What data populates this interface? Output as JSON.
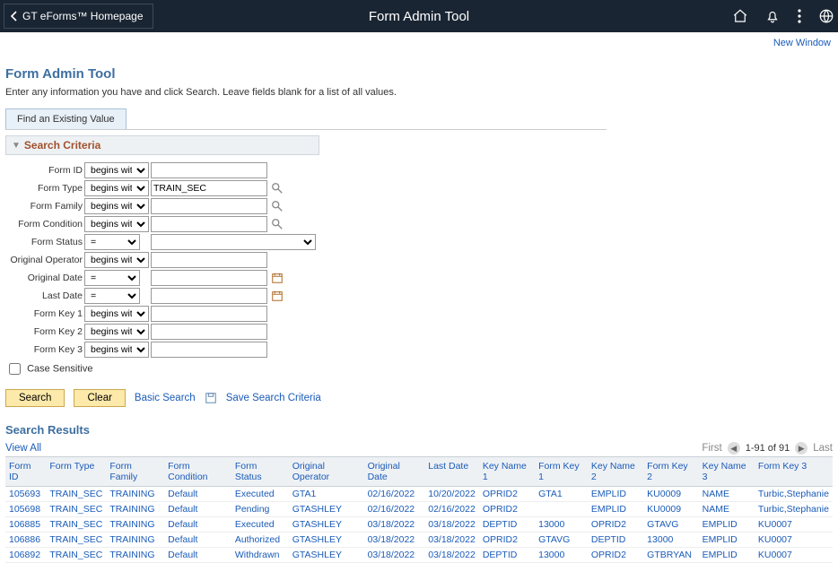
{
  "topbar": {
    "back_label": "GT eForms™ Homepage",
    "title": "Form Admin Tool"
  },
  "new_window": "New Window",
  "page": {
    "title": "Form Admin Tool",
    "help": "Enter any information you have and click Search. Leave fields blank for a list of all values.",
    "tab_label": "Find an Existing Value",
    "search_criteria_label": "Search Criteria"
  },
  "criteria": {
    "labels": {
      "form_id": "Form ID",
      "form_type": "Form Type",
      "form_family": "Form Family",
      "form_condition": "Form Condition",
      "form_status": "Form Status",
      "original_operator": "Original Operator",
      "original_date": "Original Date",
      "last_date": "Last Date",
      "form_key_1": "Form Key 1",
      "form_key_2": "Form Key 2",
      "form_key_3": "Form Key 3"
    },
    "op_begins_with": "begins with",
    "op_equals": "=",
    "values": {
      "form_type": "TRAIN_SEC"
    },
    "case_sensitive_label": "Case Sensitive"
  },
  "buttons": {
    "search": "Search",
    "clear": "Clear",
    "basic_search": "Basic Search",
    "save_criteria": "Save Search Criteria"
  },
  "results": {
    "title": "Search Results",
    "view_all": "View All",
    "first": "First",
    "range": "1-91 of 91",
    "last": "Last",
    "headers": {
      "form_id": "Form ID",
      "form_type": "Form Type",
      "form_family": "Form Family",
      "form_condition": "Form Condition",
      "form_status": "Form Status",
      "original_operator": "Original Operator",
      "original_date": "Original Date",
      "last_date": "Last Date",
      "key_name_1": "Key Name 1",
      "form_key_1": "Form Key 1",
      "key_name_2": "Key Name 2",
      "form_key_2": "Form Key 2",
      "key_name_3": "Key Name 3",
      "form_key_3": "Form Key 3"
    },
    "rows": [
      {
        "form_id": "105693",
        "form_type": "TRAIN_SEC",
        "form_family": "TRAINING",
        "form_condition": "Default",
        "form_status": "Executed",
        "original_operator": "GTA1",
        "original_date": "02/16/2022",
        "last_date": "10/20/2022",
        "key_name_1": "OPRID2",
        "form_key_1": "GTA1",
        "key_name_2": "EMPLID",
        "form_key_2": "KU0009",
        "key_name_3": "NAME",
        "form_key_3": "Turbic,Stephanie"
      },
      {
        "form_id": "105698",
        "form_type": "TRAIN_SEC",
        "form_family": "TRAINING",
        "form_condition": "Default",
        "form_status": "Pending",
        "original_operator": "GTASHLEY",
        "original_date": "02/16/2022",
        "last_date": "02/16/2022",
        "key_name_1": "OPRID2",
        "form_key_1": "",
        "key_name_2": "EMPLID",
        "form_key_2": "KU0009",
        "key_name_3": "NAME",
        "form_key_3": "Turbic,Stephanie"
      },
      {
        "form_id": "106885",
        "form_type": "TRAIN_SEC",
        "form_family": "TRAINING",
        "form_condition": "Default",
        "form_status": "Executed",
        "original_operator": "GTASHLEY",
        "original_date": "03/18/2022",
        "last_date": "03/18/2022",
        "key_name_1": "DEPTID",
        "form_key_1": "13000",
        "key_name_2": "OPRID2",
        "form_key_2": "GTAVG",
        "key_name_3": "EMPLID",
        "form_key_3": "KU0007"
      },
      {
        "form_id": "106886",
        "form_type": "TRAIN_SEC",
        "form_family": "TRAINING",
        "form_condition": "Default",
        "form_status": "Authorized",
        "original_operator": "GTASHLEY",
        "original_date": "03/18/2022",
        "last_date": "03/18/2022",
        "key_name_1": "OPRID2",
        "form_key_1": "GTAVG",
        "key_name_2": "DEPTID",
        "form_key_2": "13000",
        "key_name_3": "EMPLID",
        "form_key_3": "KU0007"
      },
      {
        "form_id": "106892",
        "form_type": "TRAIN_SEC",
        "form_family": "TRAINING",
        "form_condition": "Default",
        "form_status": "Withdrawn",
        "original_operator": "GTASHLEY",
        "original_date": "03/18/2022",
        "last_date": "03/18/2022",
        "key_name_1": "DEPTID",
        "form_key_1": "13000",
        "key_name_2": "OPRID2",
        "form_key_2": "GTBRYAN",
        "key_name_3": "EMPLID",
        "form_key_3": "KU0007"
      }
    ]
  }
}
